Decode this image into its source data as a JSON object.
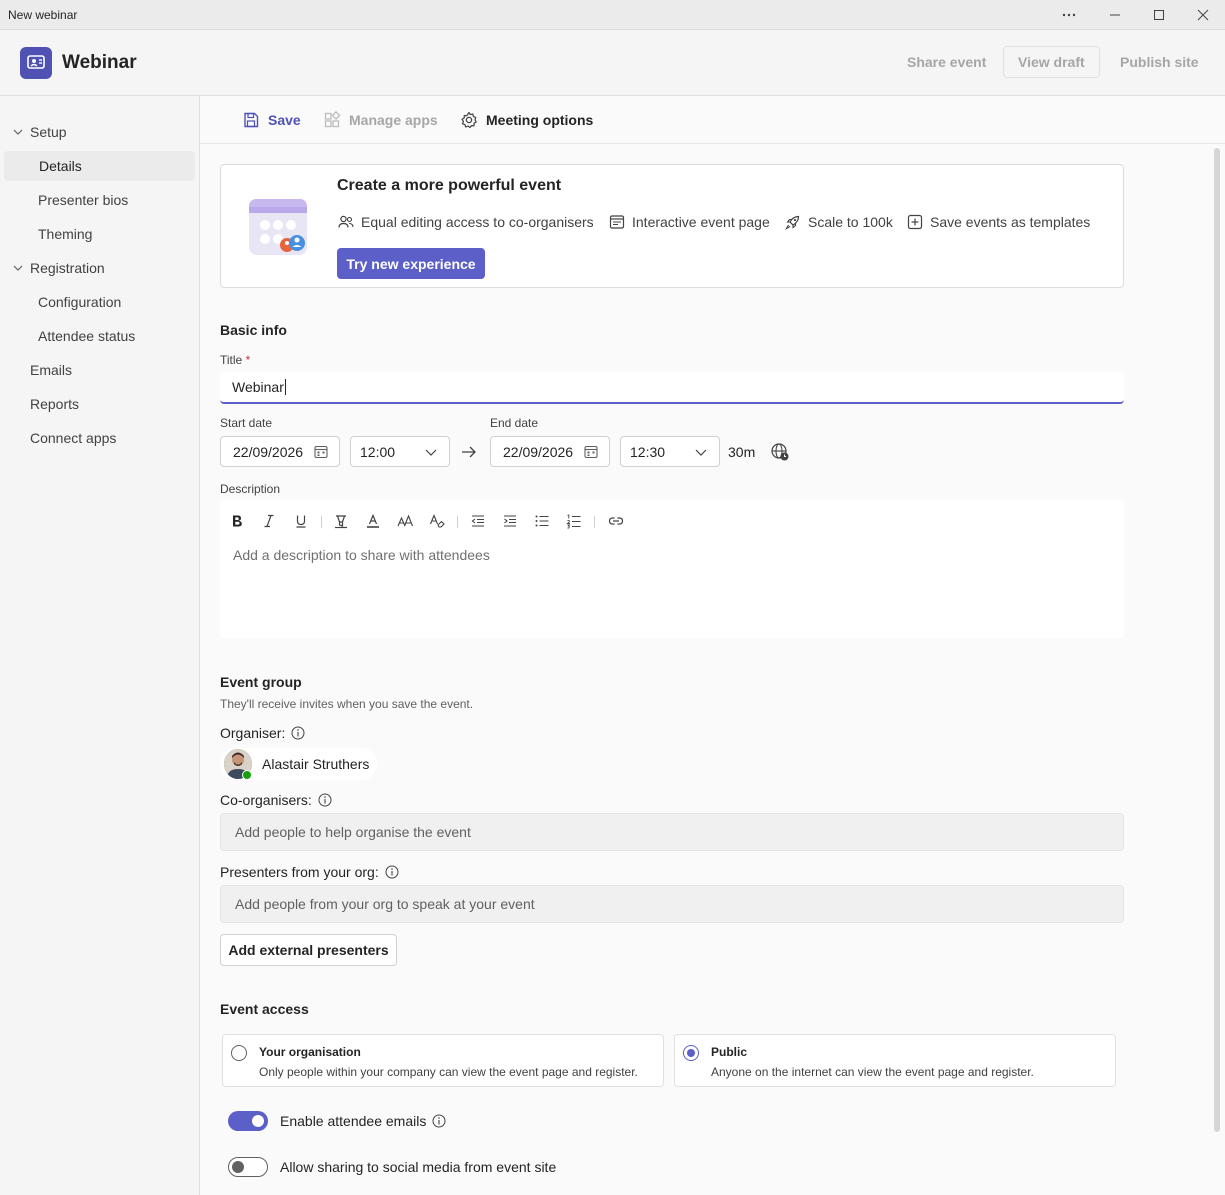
{
  "window": {
    "title": "New webinar"
  },
  "app": {
    "name": "Webinar"
  },
  "header": {
    "share_label": "Share event",
    "view_draft_label": "View draft",
    "publish_label": "Publish site"
  },
  "sidebar": {
    "setup": "Setup",
    "details": "Details",
    "presenter_bios": "Presenter bios",
    "theming": "Theming",
    "registration": "Registration",
    "configuration": "Configuration",
    "attendee_status": "Attendee status",
    "emails": "Emails",
    "reports": "Reports",
    "connect_apps": "Connect apps"
  },
  "toolbar": {
    "save": "Save",
    "manage_apps": "Manage apps",
    "meeting_options": "Meeting options"
  },
  "banner": {
    "title": "Create a more powerful event",
    "features": [
      "Equal editing access to co-organisers",
      "Interactive event page",
      "Scale to 100k",
      "Save events as templates"
    ],
    "try_label": "Try new experience"
  },
  "basic_info": {
    "heading": "Basic info",
    "title_label": "Title",
    "required_mark": "*",
    "title_value": "Webinar",
    "start_label": "Start date",
    "start_date": "22/09/2026",
    "start_time": "12:00",
    "end_label": "End date",
    "end_date": "22/09/2026",
    "end_time": "12:30",
    "duration": "30m",
    "description_label": "Description",
    "description_placeholder": "Add a description to share with attendees"
  },
  "event_group": {
    "heading": "Event group",
    "subtitle": "They'll receive invites when you save the event.",
    "organiser_label": "Organiser:",
    "organiser_name": "Alastair Struthers",
    "coorg_label": "Co-organisers:",
    "coorg_placeholder": "Add people to help organise the event",
    "presenters_label": "Presenters from your org:",
    "presenters_placeholder": "Add people from your org to speak at your event",
    "external_label": "Add external presenters"
  },
  "event_access": {
    "heading": "Event access",
    "options": [
      {
        "title": "Your organisation",
        "desc": "Only people within your company can view the event page and register.",
        "selected": false
      },
      {
        "title": "Public",
        "desc": "Anyone on the internet can view the event page and register.",
        "selected": true
      }
    ],
    "attendee_emails_label": "Enable attendee emails",
    "attendee_emails_on": true,
    "social_label": "Allow sharing to social media from event site",
    "social_on": false
  },
  "colors": {
    "accent": "#5b5fc7",
    "brand_logo": "#4f52b2"
  }
}
